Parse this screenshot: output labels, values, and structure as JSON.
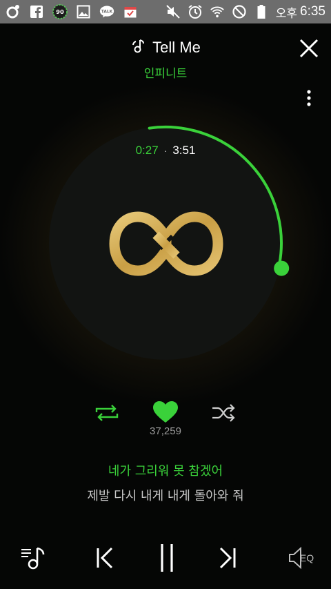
{
  "status_bar": {
    "badge_count": "90",
    "talk_label": "TALK",
    "ampm": "오후",
    "time": "6:35",
    "icons": [
      "music-app-icon",
      "facebook-icon",
      "badge-icon",
      "gallery-icon",
      "kakaotalk-icon",
      "calendar-icon",
      "mute-icon",
      "alarm-icon",
      "wifi-icon",
      "block-icon",
      "battery-icon"
    ]
  },
  "player": {
    "title": "Tell Me",
    "artist": "인피니트",
    "elapsed": "0:27",
    "separator": "·",
    "total": "3:51",
    "progress_fraction": 0.117,
    "like_count": "37,259",
    "lyrics": {
      "current": "네가 그리워 못 참겠어",
      "next": "제발 다시 내게 내게 돌아와 줘"
    },
    "eq_label": "EQ"
  },
  "colors": {
    "accent": "#3ad13a",
    "logo_gold": "#d4b15e",
    "background": "#050605",
    "status_bar": "#6d6d6d"
  }
}
